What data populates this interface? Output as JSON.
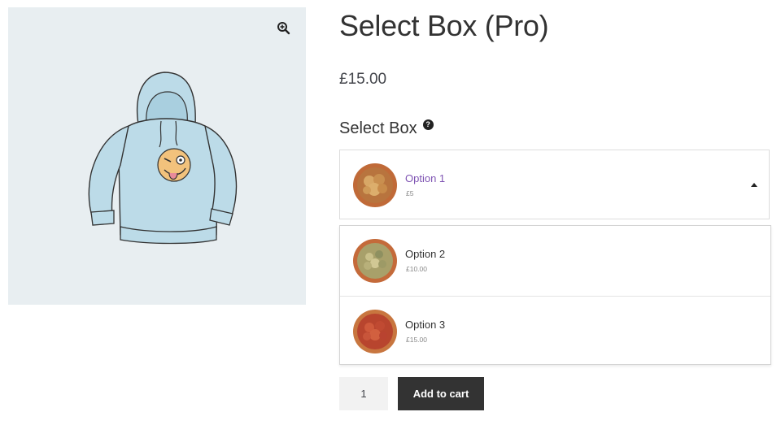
{
  "product": {
    "title": "Select Box (Pro)",
    "price": "£15.00"
  },
  "gallery": {
    "zoom_icon": "zoom-in-icon",
    "image": "hoodie-with-winking-emoji"
  },
  "field": {
    "label": "Select Box",
    "help_icon": "question-icon",
    "help_glyph": "?"
  },
  "select": {
    "selected": {
      "name": "Option 1",
      "price": "£5"
    },
    "caret_icon": "caret-up-icon",
    "options": [
      {
        "name": "Option 2",
        "price": "£10.00"
      },
      {
        "name": "Option 3",
        "price": "£15.00"
      }
    ]
  },
  "cart": {
    "quantity": "1",
    "button_label": "Add to cart"
  },
  "colors": {
    "accent": "#7f54b3",
    "button_bg": "#333333",
    "gallery_bg": "#e8eef1"
  }
}
